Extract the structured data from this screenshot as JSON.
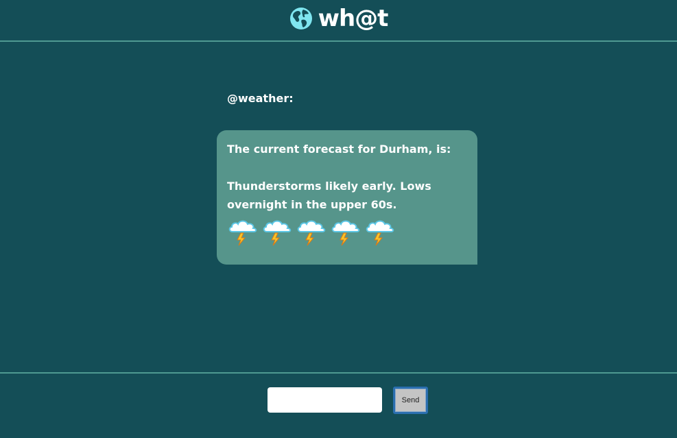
{
  "app": {
    "name": "wh@t",
    "logo_icon": "globe-icon"
  },
  "chat": {
    "sender": "@weather:",
    "message": {
      "line1": "The current forecast for Durham, is:",
      "line2": "Thunderstorms likely early. Lows overnight in the upper 60s.",
      "icons": [
        "thunderstorm-icon",
        "thunderstorm-icon",
        "thunderstorm-icon",
        "thunderstorm-icon",
        "thunderstorm-icon"
      ]
    }
  },
  "composer": {
    "input_value": "",
    "send_label": "Send"
  },
  "colors": {
    "background": "#144e57",
    "divider": "#4f9a92",
    "bubble": "#56958b",
    "globe": "#7fe6f0",
    "send_border": "#2b6fb0"
  }
}
